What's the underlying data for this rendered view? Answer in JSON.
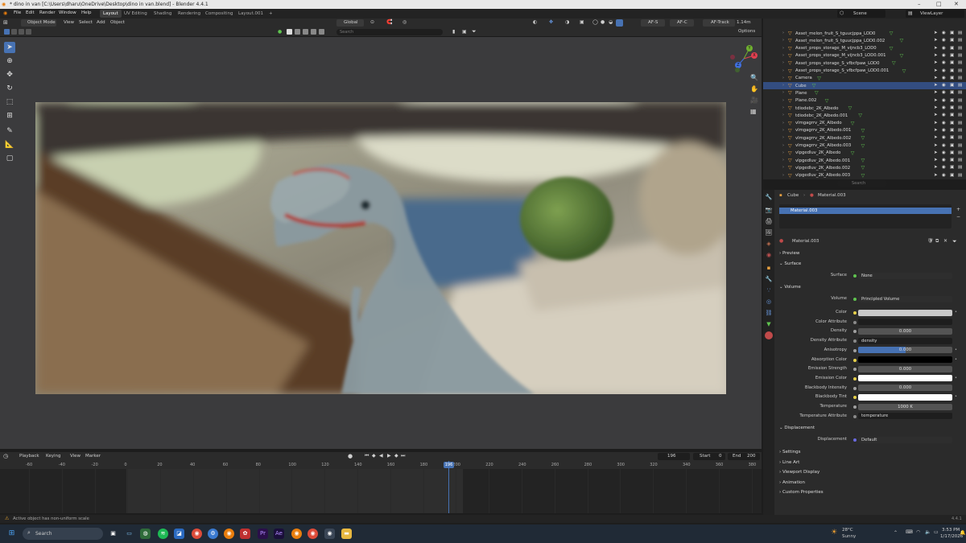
{
  "window": {
    "title": "* dino in van [C:\\Users\\dharu\\OneDrive\\Desktop\\dino in van.blend] - Blender 4.4.1",
    "minimize_glyph": "–",
    "maximize_glyph": "□",
    "close_glyph": "✕"
  },
  "menu": [
    "File",
    "Edit",
    "Render",
    "Window",
    "Help"
  ],
  "workspaces": [
    "Layout",
    "UV Editing",
    "Shading",
    "Rendering",
    "Compositing",
    "Layout.001"
  ],
  "workspace_add": "+",
  "scene": {
    "name": "Scene",
    "view_layer": "ViewLayer"
  },
  "viewport_header": {
    "mode": "Object Mode",
    "menus": [
      "View",
      "Select",
      "Add",
      "Object"
    ],
    "orientation": "Global",
    "search_placeholder": "Search",
    "af_s": "AF-S",
    "af_c": "AF-C",
    "af_track": "AF-Track",
    "focal": "1.14m",
    "options": "Options"
  },
  "gizmo": {
    "x": "X",
    "y": "Y",
    "z": "Z"
  },
  "outliner": {
    "rows": [
      {
        "name": "Asset_melon_fruit_S_tguucjppa_LOD0",
        "selected": false
      },
      {
        "name": "Asset_melon_fruit_S_tguucjppa_LOD0.002",
        "selected": false
      },
      {
        "name": "Asset_props_storage_M_vijncb3_LOD0",
        "selected": false
      },
      {
        "name": "Asset_props_storage_M_vijncb3_LOD0.001",
        "selected": false
      },
      {
        "name": "Asset_props_storage_S_vfbcfpaw_LOD0",
        "selected": false
      },
      {
        "name": "Asset_props_storage_S_vfbcfpaw_LOD0.001",
        "selected": false
      },
      {
        "name": "Camera",
        "selected": false
      },
      {
        "name": "Cube",
        "selected": true
      },
      {
        "name": "Plane",
        "selected": false
      },
      {
        "name": "Plane.002",
        "selected": false
      },
      {
        "name": "tdiodebc_2K_Albedo",
        "selected": false
      },
      {
        "name": "tdiodebc_2K_Albedo.001",
        "selected": false
      },
      {
        "name": "vlmgagrrv_2K_Albedo",
        "selected": false
      },
      {
        "name": "vlmgagrrv_2K_Albedo.001",
        "selected": false
      },
      {
        "name": "vlmgagrrv_2K_Albedo.002",
        "selected": false
      },
      {
        "name": "vlmgagrrv_2K_Albedo.003",
        "selected": false
      },
      {
        "name": "vlpgedluv_2K_Albedo",
        "selected": false
      },
      {
        "name": "vlpgedluv_2K_Albedo.001",
        "selected": false
      },
      {
        "name": "vlpgedluv_2K_Albedo.002",
        "selected": false
      },
      {
        "name": "vlpgedluv_2K_Albedo.003",
        "selected": false
      }
    ]
  },
  "properties": {
    "search_placeholder": "Search",
    "breadcrumb_object": "Cube",
    "breadcrumb_material": "Material.003",
    "slot": "Material.003",
    "material_name": "Material.003",
    "sections": {
      "preview": "Preview",
      "surface": "Surface",
      "volume": "Volume",
      "displacement": "Displacement",
      "settings": "Settings",
      "line_art": "Line Art",
      "viewport_display": "Viewport Display",
      "animation": "Animation",
      "custom_properties": "Custom Properties"
    },
    "surface_label": "Surface",
    "surface_value": "None",
    "volume_label": "Volume",
    "volume_value": "Principled Volume",
    "fields": [
      {
        "label": "Color",
        "value": "",
        "kind": "color",
        "color": "#c8c8c8",
        "dot": "#e6d04a"
      },
      {
        "label": "Color Attribute",
        "value": "",
        "kind": "text",
        "dot": "#8a8a8a"
      },
      {
        "label": "Density",
        "value": "0.000",
        "kind": "num",
        "dot": "#a0a0a0"
      },
      {
        "label": "Density Attribute",
        "value": "density",
        "kind": "text",
        "dot": "#8a8a8a"
      },
      {
        "label": "Anisotropy",
        "value": "0.000",
        "kind": "slider",
        "dot": "#a0a0a0"
      },
      {
        "label": "Absorption Color",
        "value": "",
        "kind": "color",
        "color": "#000000",
        "dot": "#e6d04a"
      },
      {
        "label": "Emission Strength",
        "value": "0.000",
        "kind": "num",
        "dot": "#a0a0a0"
      },
      {
        "label": "Emission Color",
        "value": "",
        "kind": "color",
        "color": "#ffffff",
        "dot": "#e6d04a"
      },
      {
        "label": "Blackbody Intensity",
        "value": "0.000",
        "kind": "num",
        "dot": "#a0a0a0"
      },
      {
        "label": "Blackbody Tint",
        "value": "",
        "kind": "color",
        "color": "#ffffff",
        "dot": "#e6d04a"
      },
      {
        "label": "Temperature",
        "value": "1000 K",
        "kind": "num",
        "dot": "#a0a0a0"
      },
      {
        "label": "Temperature Attribute",
        "value": "temperature",
        "kind": "text",
        "dot": "#8a8a8a"
      }
    ],
    "anisotropy_fill": 0.5,
    "displacement_label": "Displacement",
    "displacement_value": "Default"
  },
  "timeline": {
    "menus": [
      "Playback",
      "Keying",
      "View",
      "Marker"
    ],
    "current_frame": "196",
    "start_label": "Start",
    "start": "0",
    "end_label": "End",
    "end": "200",
    "ticks": [
      "-60",
      "-40",
      "-20",
      "0",
      "20",
      "40",
      "60",
      "80",
      "100",
      "120",
      "140",
      "160",
      "180",
      "200",
      "220",
      "240",
      "260",
      "280",
      "300",
      "320",
      "340",
      "360",
      "380"
    ],
    "playhead_label": "196"
  },
  "status": {
    "message": "Active object has non-uniform scale",
    "version": "4.4.1"
  },
  "taskbar": {
    "search_placeholder": "Search",
    "weather_temp": "28°C",
    "weather_desc": "Sunny",
    "time": "3:53 PM",
    "date": "1/17/2026"
  },
  "colors": {
    "accent": "#4772b3",
    "selection": "#334d80",
    "bg": "#1d1d1d"
  }
}
